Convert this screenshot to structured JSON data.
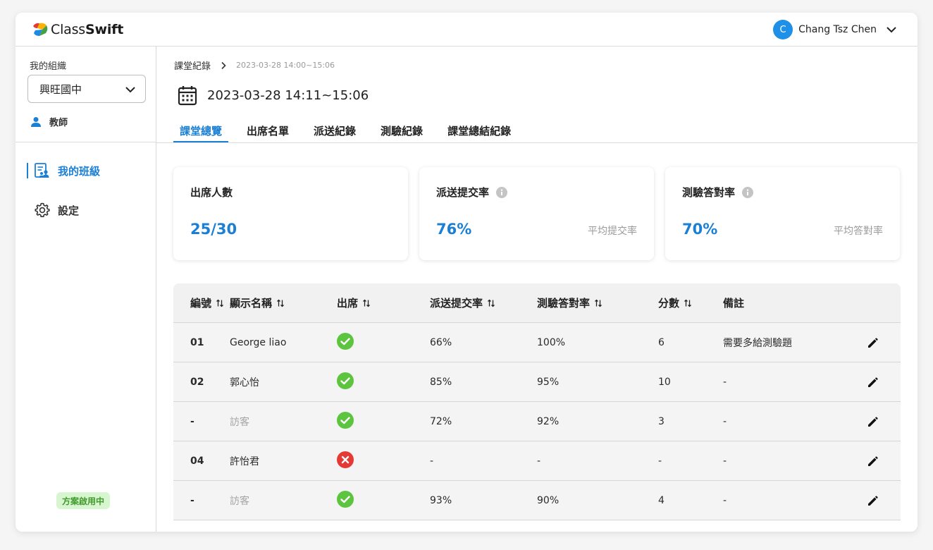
{
  "app": {
    "logo_prefix": "Class",
    "logo_bold": "Swift"
  },
  "user": {
    "initial": "C",
    "name": "Chang Tsz Chen"
  },
  "sidebar": {
    "org_label": "我的組織",
    "org_selected": "興旺國中",
    "role": "教師",
    "nav": [
      {
        "label": "我的班級",
        "active": true
      },
      {
        "label": "設定",
        "active": false
      }
    ],
    "plan_badge": "方案啟用中"
  },
  "breadcrumb": {
    "root": "課堂紀錄",
    "current": "2023-03-28  14:00~15:06"
  },
  "page_title": "2023-03-28  14:11~15:06",
  "tabs": [
    "課堂總覽",
    "出席名單",
    "派送紀錄",
    "測驗紀錄",
    "課堂總結紀錄"
  ],
  "active_tab": "課堂總覽",
  "stats": [
    {
      "title": "出席人數",
      "value": "25/30",
      "sub": "",
      "has_info": false
    },
    {
      "title": "派送提交率",
      "value": "76%",
      "sub": "平均提交率",
      "has_info": true
    },
    {
      "title": "測驗答對率",
      "value": "70%",
      "sub": "平均答對率",
      "has_info": true
    }
  ],
  "table": {
    "columns": [
      "編號",
      "顯示名稱",
      "出席",
      "派送提交率",
      "測驗答對率",
      "分數",
      "備註"
    ],
    "rows": [
      {
        "id": "01",
        "name": "George liao",
        "guest": false,
        "attended": true,
        "submit": "66%",
        "accuracy": "100%",
        "score": "6",
        "note": "需要多給測驗題"
      },
      {
        "id": "02",
        "name": "郭心怡",
        "guest": false,
        "attended": true,
        "submit": "85%",
        "accuracy": "95%",
        "score": "10",
        "note": "-"
      },
      {
        "id": "-",
        "name": "訪客",
        "guest": true,
        "attended": true,
        "submit": "72%",
        "accuracy": "92%",
        "score": "3",
        "note": "-"
      },
      {
        "id": "04",
        "name": "許怡君",
        "guest": false,
        "attended": false,
        "submit": "-",
        "accuracy": "-",
        "score": "-",
        "note": "-"
      },
      {
        "id": "-",
        "name": "訪客",
        "guest": true,
        "attended": true,
        "submit": "93%",
        "accuracy": "90%",
        "score": "4",
        "note": "-"
      }
    ]
  },
  "colors": {
    "accent": "#1b7fd4",
    "present": "#5cc43f",
    "absent": "#e53935",
    "badge_bg": "#d7f5cf",
    "badge_text": "#3f9a2b"
  },
  "icons": {
    "attended": "check-circle-icon",
    "absent": "x-circle-icon",
    "edit": "pencil-icon",
    "sort": "sort-arrows-icon",
    "info": "info-icon"
  }
}
